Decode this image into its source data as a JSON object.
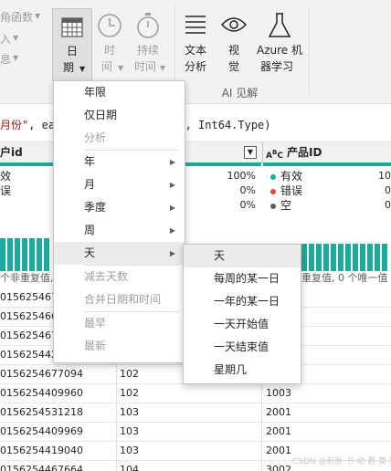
{
  "ribbon": {
    "left_items": [
      "角函数",
      "入",
      "息"
    ],
    "date": {
      "line1": "日",
      "line2": "期"
    },
    "time": {
      "line1": "时",
      "line2": "间"
    },
    "duration": {
      "line1": "持续",
      "line2": "时间"
    },
    "text_analysis": {
      "line1": "文本",
      "line2": "分析"
    },
    "vision": {
      "line1": "视",
      "line2": "觉"
    },
    "azure_ml": {
      "line1": "Azure 机",
      "line2": "器学习"
    },
    "ai_group_label": "AI 见解"
  },
  "formula": {
    "prefix": "",
    "string": "月份\"",
    "middle": ", ea",
    "suffix": "期]), Int64.Type)"
  },
  "columns": {
    "col1": {
      "header": "户id"
    },
    "col2": {
      "header": ""
    },
    "col3": {
      "header": "产品ID",
      "type_icon": "A B C"
    }
  },
  "stats": {
    "col1_labels": [
      "效",
      "误",
      ""
    ],
    "col2_pcts": [
      "100%",
      "0%",
      "0%"
    ],
    "col3": [
      {
        "label": "有效",
        "pct": "10",
        "color": "#1aab9b"
      },
      {
        "label": "错误",
        "pct": "0",
        "color": "#e8403d"
      },
      {
        "label": "空",
        "pct": "0",
        "color": "#605e5c"
      }
    ],
    "distinct_col1": "个非重复值,",
    "distinct_col3": "重复值, 0 个唯一值"
  },
  "rows": [
    {
      "c1": "0156254676",
      "c2": "",
      "c3": ""
    },
    {
      "c1": "0156254661",
      "c2": "",
      "c3": ""
    },
    {
      "c1": "0156254676",
      "c2": "",
      "c3": ""
    },
    {
      "c1": "0156254429",
      "c2": "",
      "c3": ""
    },
    {
      "c1": "0156254677094",
      "c2": "102",
      "c3": ""
    },
    {
      "c1": "0156254409960",
      "c2": "102",
      "c3": "1003"
    },
    {
      "c1": "0156254531218",
      "c2": "103",
      "c3": "2001"
    },
    {
      "c1": "0156254409969",
      "c2": "103",
      "c3": "2001"
    },
    {
      "c1": "0156254419040",
      "c2": "103",
      "c3": "2001"
    },
    {
      "c1": "0156254467664",
      "c2": "104",
      "c3": "3002"
    }
  ],
  "date_menu": {
    "items": [
      {
        "label": "年限",
        "disabled": false,
        "submenu": false
      },
      {
        "label": "仅日期",
        "disabled": false,
        "submenu": false
      },
      {
        "label": "分析",
        "disabled": true,
        "submenu": false
      },
      {
        "label": "年",
        "disabled": false,
        "submenu": true
      },
      {
        "label": "月",
        "disabled": false,
        "submenu": true
      },
      {
        "label": "季度",
        "disabled": false,
        "submenu": true
      },
      {
        "label": "周",
        "disabled": false,
        "submenu": true
      },
      {
        "label": "天",
        "disabled": false,
        "submenu": true,
        "highlighted": true
      },
      {
        "label": "减去天数",
        "disabled": true,
        "submenu": false
      },
      {
        "label": "合并日期和时间",
        "disabled": true,
        "submenu": false
      },
      {
        "label": "最早",
        "disabled": true,
        "submenu": false
      },
      {
        "label": "最新",
        "disabled": true,
        "submenu": false
      }
    ]
  },
  "day_submenu": {
    "items": [
      "天",
      "每周的某一日",
      "一年的某一日",
      "一天开始值",
      "一天结束值",
      "星期几"
    ]
  },
  "watermark": "CSDN @前卧·书·动·君·莫·笑"
}
